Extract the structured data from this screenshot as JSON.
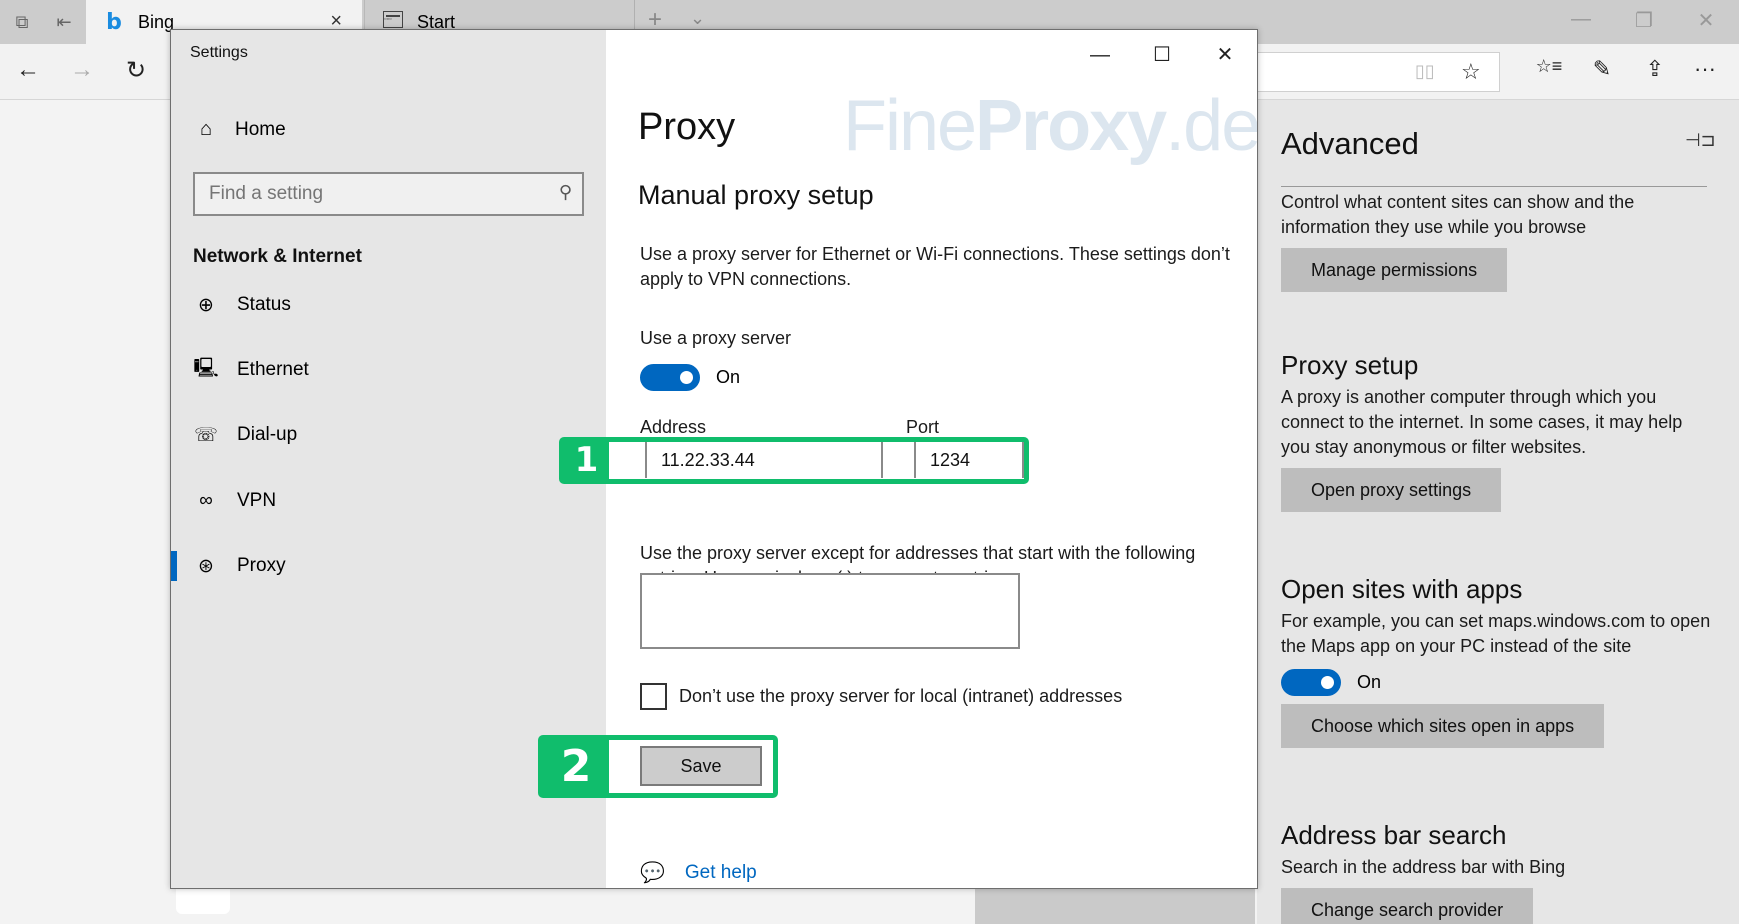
{
  "browser": {
    "tabs": [
      {
        "label": "Bing",
        "icon": "bing-logo",
        "active": true,
        "close_icon": "×"
      },
      {
        "label": "Start",
        "icon": "start-page-icon",
        "active": false
      }
    ],
    "tab_actions": {
      "new_tab": "+",
      "tab_list": "⌄"
    },
    "window_controls": {
      "minimize": "—",
      "restore": "❐",
      "close": "✕"
    },
    "nav": {
      "back": "←",
      "forward": "→",
      "refresh": "↻"
    },
    "toolbar_icons": {
      "reading_view": "📖",
      "favorite": "☆",
      "favorites_hub": "☆≡",
      "notes": "✎",
      "share": "⇪",
      "more": "···"
    }
  },
  "settings_window": {
    "title": "Settings",
    "controls": {
      "minimize": "—",
      "maximize": "☐",
      "close": "✕"
    },
    "sidebar": {
      "home_label": "Home",
      "search_placeholder": "Find a setting",
      "category": "Network & Internet",
      "items": [
        {
          "label": "Status",
          "icon": "status-globe-icon",
          "glyph": "⊕",
          "selected": false
        },
        {
          "label": "Ethernet",
          "icon": "ethernet-icon",
          "glyph": "🖳",
          "selected": false
        },
        {
          "label": "Dial-up",
          "icon": "dial-up-icon",
          "glyph": "☏",
          "selected": false
        },
        {
          "label": "VPN",
          "icon": "vpn-icon",
          "glyph": "∞",
          "selected": false
        },
        {
          "label": "Proxy",
          "icon": "proxy-globe-icon",
          "glyph": "🌐",
          "selected": true
        }
      ]
    },
    "content": {
      "watermark_light": "Fine",
      "watermark_bold": "Proxy",
      "watermark_suffix": ".de",
      "title": "Proxy",
      "subtitle": "Manual proxy setup",
      "description": "Use a proxy server for Ethernet or Wi-Fi connections. These settings don’t apply to VPN connections.",
      "use_proxy_label": "Use a proxy server",
      "use_proxy_state": "On",
      "address_label": "Address",
      "address_value": "11.22.33.44",
      "port_label": "Port",
      "port_value": "1234",
      "exceptions_text": "Use the proxy server except for addresses that start with the following entries. Use semicolons (;) to separate entries.",
      "exceptions_value": "",
      "local_checkbox_label": "Don’t use the proxy server for local (intranet) addresses",
      "local_checkbox_checked": false,
      "save_label": "Save",
      "help_label": "Get help"
    },
    "annotations": [
      {
        "number": "1",
        "target": "address-and-port"
      },
      {
        "number": "2",
        "target": "save-button"
      }
    ]
  },
  "edge_panel": {
    "title": "Advanced",
    "pin_icon": "⊣⊐",
    "intro": "Control what content sites can show and the information they use while you browse",
    "manage_permissions": "Manage permissions",
    "sections": [
      {
        "heading": "Proxy setup",
        "text": "A proxy is another computer through which you connect to the internet. In some cases, it may help you stay anonymous or filter websites.",
        "button": "Open proxy settings"
      },
      {
        "heading": "Open sites with apps",
        "text": "For example, you can set maps.windows.com to open the Maps app on your PC instead of the site",
        "toggle_state": "On",
        "button": "Choose which sites open in apps"
      },
      {
        "heading": "Address bar search",
        "text": "Search in the address bar with Bing",
        "button": "Change search provider"
      }
    ]
  },
  "colors": {
    "accent": "#0067c0",
    "annotation_green": "#10bd6c",
    "watermark": "#dce6ef"
  }
}
